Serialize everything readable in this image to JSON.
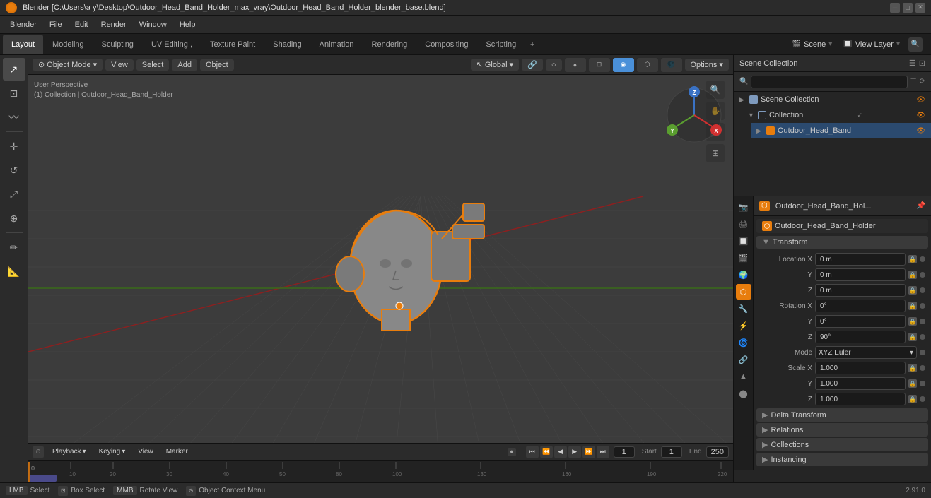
{
  "titleBar": {
    "title": "Blender [C:\\Users\\a y\\Desktop\\Outdoor_Head_Band_Holder_max_vray\\Outdoor_Head_Band_Holder_blender_base.blend]",
    "appIcon": "blender-icon"
  },
  "menuBar": {
    "items": [
      "Blender",
      "File",
      "Edit",
      "Render",
      "Window",
      "Help"
    ]
  },
  "tabs": {
    "items": [
      {
        "label": "Layout",
        "active": true
      },
      {
        "label": "Modeling",
        "active": false
      },
      {
        "label": "Sculpting",
        "active": false
      },
      {
        "label": "UV Editing ,",
        "active": false
      },
      {
        "label": "Texture Paint",
        "active": false
      },
      {
        "label": "Shading",
        "active": false
      },
      {
        "label": "Animation",
        "active": false
      },
      {
        "label": "Rendering",
        "active": false
      },
      {
        "label": "Compositing",
        "active": false
      },
      {
        "label": "Scripting",
        "active": false
      }
    ],
    "addIcon": "+",
    "sceneLabel": "Scene",
    "viewLayerLabel": "View Layer",
    "filterIcon": "🔍"
  },
  "viewport": {
    "mode": "Object Mode",
    "modeIcon": "▾",
    "viewLabel": "View",
    "selectLabel": "Select",
    "addLabel": "Add",
    "objectLabel": "Object",
    "transformMode": "Global",
    "snapLabel": "🔗",
    "proportionalLabel": "○",
    "optionsLabel": "Options ▾",
    "viewInfo": {
      "line1": "User Perspective",
      "line2": "(1) Collection | Outdoor_Head_Band_Holder"
    },
    "gizmos": [
      "🔍",
      "✋",
      "🎥",
      "⊞"
    ],
    "navGizmo": {
      "x": "X",
      "y": "Y",
      "z": "Z",
      "xColor": "#d13030",
      "yColor": "#5a9e2f",
      "zColor": "#3a72c4"
    }
  },
  "leftToolbar": {
    "tools": [
      {
        "icon": "↗",
        "name": "select-tool",
        "active": true
      },
      {
        "icon": "⊡",
        "name": "box-select-tool",
        "active": false
      },
      {
        "icon": "⊙",
        "name": "lasso-select-tool",
        "active": false
      },
      {
        "icon": "✛",
        "name": "move-tool",
        "active": false
      },
      {
        "icon": "↺",
        "name": "rotate-tool",
        "active": false
      },
      {
        "icon": "⤢",
        "name": "scale-tool",
        "active": false
      },
      {
        "icon": "⊞",
        "name": "transform-tool",
        "active": false
      },
      {
        "separator": true
      },
      {
        "icon": "✏",
        "name": "annotate-tool",
        "active": false
      },
      {
        "icon": "📐",
        "name": "measure-tool",
        "active": false
      }
    ]
  },
  "outliner": {
    "searchPlaceholder": "",
    "sceneCollectionLabel": "Scene Collection",
    "items": [
      {
        "label": "Collection",
        "type": "collection",
        "indent": 0,
        "expanded": true,
        "visible": true,
        "checkColor": "#7e9abd"
      },
      {
        "label": "Outdoor_Head_Band",
        "type": "object",
        "indent": 1,
        "expanded": false,
        "visible": true,
        "selected": true,
        "checkColor": "#f5c542"
      }
    ]
  },
  "propertiesPanel": {
    "objectName": "Outdoor_Head_Band_Hol...",
    "pinIcon": "📌",
    "objectDisplayName": "Outdoor_Head_Band_Holder",
    "transform": {
      "label": "Transform",
      "locationX": "0 m",
      "locationY": "0 m",
      "locationZ": "0 m",
      "rotationX": "0°",
      "rotationY": "0°",
      "rotationZ": "90°",
      "rotationMode": "XYZ Euler",
      "scaleX": "1.000",
      "scaleY": "1.000",
      "scaleZ": "1.000"
    },
    "sections": [
      {
        "label": "Delta Transform",
        "collapsed": true
      },
      {
        "label": "Relations",
        "collapsed": true
      },
      {
        "label": "Collections",
        "collapsed": true
      },
      {
        "label": "Instancing",
        "collapsed": true
      }
    ],
    "propIcons": [
      {
        "icon": "⊡",
        "name": "render-icon",
        "active": false
      },
      {
        "icon": "📷",
        "name": "output-icon",
        "active": false
      },
      {
        "icon": "👁",
        "name": "view-layer-icon",
        "active": false
      },
      {
        "icon": "🎬",
        "name": "scene-icon",
        "active": false
      },
      {
        "icon": "🌍",
        "name": "world-icon",
        "active": false
      },
      {
        "icon": "🔧",
        "name": "object-icon",
        "active": true
      },
      {
        "icon": "⊙",
        "name": "modifier-icon",
        "active": false
      },
      {
        "icon": "⚡",
        "name": "particles-icon",
        "active": false
      },
      {
        "icon": "🌀",
        "name": "physics-icon",
        "active": false
      },
      {
        "icon": "⬡",
        "name": "constraints-icon",
        "active": false
      },
      {
        "icon": "🔲",
        "name": "data-icon",
        "active": false
      },
      {
        "icon": "🎨",
        "name": "material-icon",
        "active": false
      }
    ]
  },
  "timeline": {
    "playbackLabel": "Playback",
    "keyingLabel": "Keying",
    "viewLabel": "View",
    "markerLabel": "Marker",
    "currentFrame": "1",
    "startFrame": "1",
    "endFrame": "250",
    "playIcon": "▶",
    "startFrameLabel": "Start",
    "endFrameLabel": "End"
  },
  "statusBar": {
    "items": [
      {
        "key": "LMB",
        "label": "Select"
      },
      {
        "key": "⊡",
        "label": "Box Select"
      },
      {
        "key": "MMB",
        "label": "Rotate View"
      },
      {
        "key": "⊙",
        "label": "Object Context Menu"
      }
    ],
    "version": "2.91.0"
  }
}
